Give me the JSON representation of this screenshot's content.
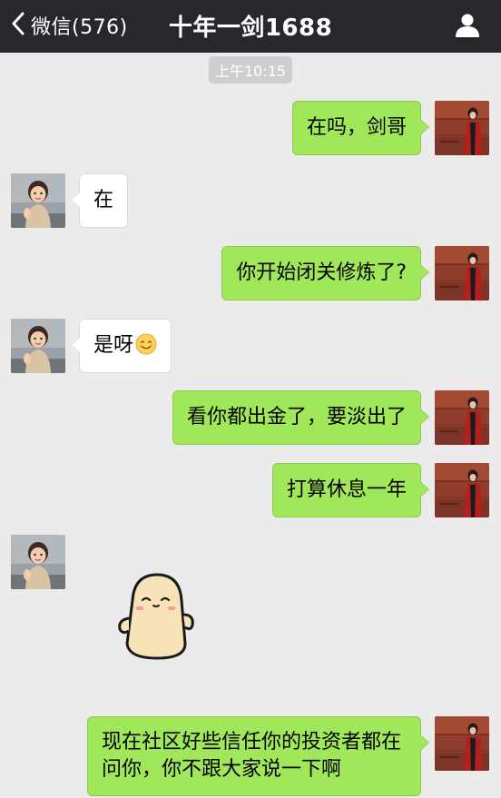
{
  "header": {
    "back_label": "微信(576)",
    "title": "十年一剑1688"
  },
  "timestamp": "上午10:15",
  "messages": [
    {
      "from": "me",
      "text": "在吗，剑哥"
    },
    {
      "from": "friend",
      "text": "在"
    },
    {
      "from": "me",
      "text": "你开始闭关修炼了?"
    },
    {
      "from": "friend",
      "text": "是呀",
      "emoji": "smile-emoji"
    },
    {
      "from": "me",
      "text": "看你都出金了，要淡出了"
    },
    {
      "from": "me",
      "text": "打算休息一年"
    },
    {
      "from": "friend",
      "sticker": "bean-character-sticker"
    },
    {
      "from": "me",
      "text": "现在社区好些信任你的投资者都在问你，你不跟大家说一下啊"
    }
  ],
  "colors": {
    "navbar": "#28282c",
    "background": "#ebebeb",
    "outgoing_bubble": "#a0e75a",
    "incoming_bubble": "#ffffff"
  },
  "icons": {
    "back": "chevron-left-icon",
    "profile": "person-icon"
  }
}
